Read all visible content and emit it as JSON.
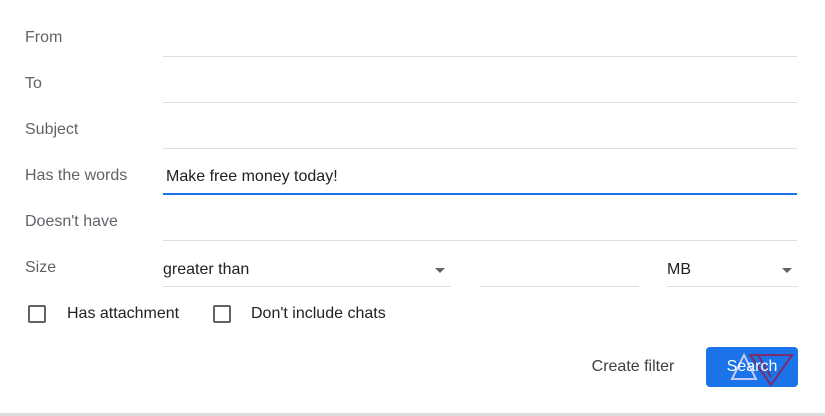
{
  "form": {
    "from": {
      "label": "From",
      "value": ""
    },
    "to": {
      "label": "To",
      "value": ""
    },
    "subject": {
      "label": "Subject",
      "value": ""
    },
    "has_words": {
      "label": "Has the words",
      "value": "Make free money today!"
    },
    "doesnt_have": {
      "label": "Doesn't have",
      "value": ""
    },
    "size": {
      "label": "Size",
      "comparator": "greater than",
      "value": "",
      "unit": "MB"
    }
  },
  "checkboxes": {
    "has_attachment": {
      "label": "Has attachment",
      "checked": false
    },
    "dont_include_chats": {
      "label": "Don't include chats",
      "checked": false
    }
  },
  "actions": {
    "create_filter": "Create filter",
    "search": "Search"
  },
  "colors": {
    "accent": "#1a73e8",
    "label": "#5f6368",
    "divider": "#e0e0e0"
  },
  "icons": {
    "dropdown": "chevron-down-icon",
    "watermark": "android-police-logo"
  }
}
